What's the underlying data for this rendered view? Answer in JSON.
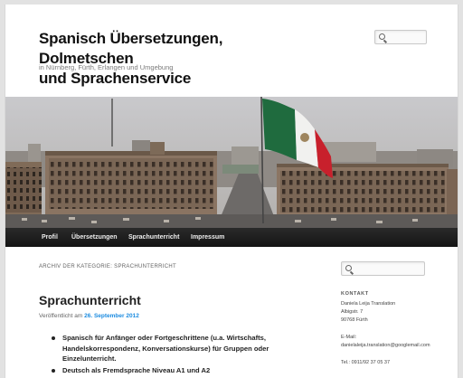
{
  "site": {
    "title_line1": "Spanisch Übersetzungen, Dolmetschen",
    "title_line2": "und Sprachenservice",
    "description": "in Nürnberg, Fürth, Erlangen und Umgebung"
  },
  "search": {
    "top_placeholder": "",
    "sidebar_placeholder": ""
  },
  "nav": {
    "items": [
      "Profil",
      "Übersetzungen",
      "Sprachunterricht",
      "Impressum"
    ]
  },
  "archive_label": "Archiv der Kategorie: Sprachunterricht",
  "post": {
    "title": "Sprachunterricht",
    "published_prefix": "Veröffentlicht am",
    "published_date": "26. September 2012",
    "bullets": [
      "Spanisch für Anfänger oder Fortgeschrittene (u.a. Wirtschafts, Handelskorrespondenz, Konversationskurse) für Gruppen oder Einzelunterricht.",
      "Deutsch als Fremdsprache Niveau A1 und A2"
    ]
  },
  "sidebar": {
    "heading": "KONTAKT",
    "name": "Daniela Leija Translation",
    "street": "Albigstr. 7",
    "city": "90768 Fürth",
    "email_label": "E-Mail:",
    "email": "danielaleija.translation@googlemail.com",
    "phone": "Tel.: 0911/92 37 05 37"
  },
  "colors": {
    "nav_bg": "#1a1a1a",
    "link": "#1b8be0",
    "flag_green": "#1f6b3e",
    "flag_red": "#c8202c"
  }
}
